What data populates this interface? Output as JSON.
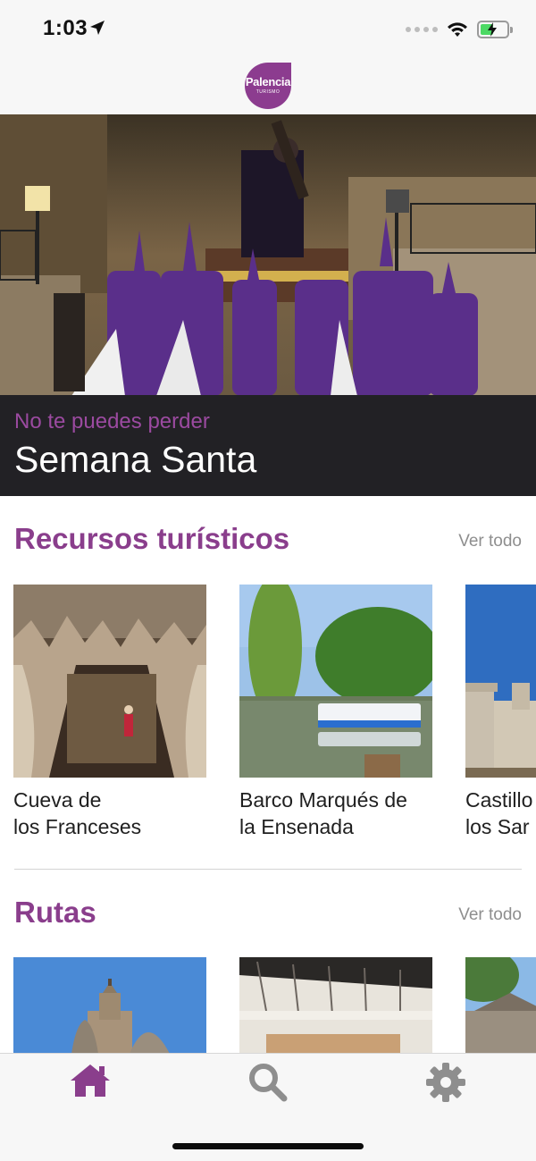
{
  "status_bar": {
    "time": "1:03",
    "location_icon": "location-arrow-icon",
    "signal_icon": "cellular-signal-icon",
    "wifi_icon": "wifi-icon",
    "battery_icon": "battery-charging-icon",
    "battery_color": "#4cd964"
  },
  "header": {
    "logo_title": "Palencia",
    "logo_subtitle": "TURISMO",
    "logo_color": "#8c3c8f"
  },
  "hero": {
    "eyebrow": "No te puedes perder",
    "title": "Semana Santa",
    "eyebrow_color": "#9b4aa0"
  },
  "sections": {
    "resources": {
      "title": "Recursos turísticos",
      "see_all": "Ver todo",
      "items": [
        {
          "label": "Cueva de\nlos Franceses"
        },
        {
          "label": "Barco Marqués de\nla Ensenada"
        },
        {
          "label": "Castillo\nlos Sar"
        }
      ]
    },
    "routes": {
      "title": "Rutas",
      "see_all": "Ver todo"
    }
  },
  "tab_bar": {
    "tabs": [
      {
        "icon": "home-icon",
        "active": true
      },
      {
        "icon": "search-icon",
        "active": false
      },
      {
        "icon": "gear-icon",
        "active": false
      }
    ],
    "active_color": "#8a3e8c",
    "inactive_color": "#8e8e8e"
  },
  "accent_color": "#8a3e8c"
}
